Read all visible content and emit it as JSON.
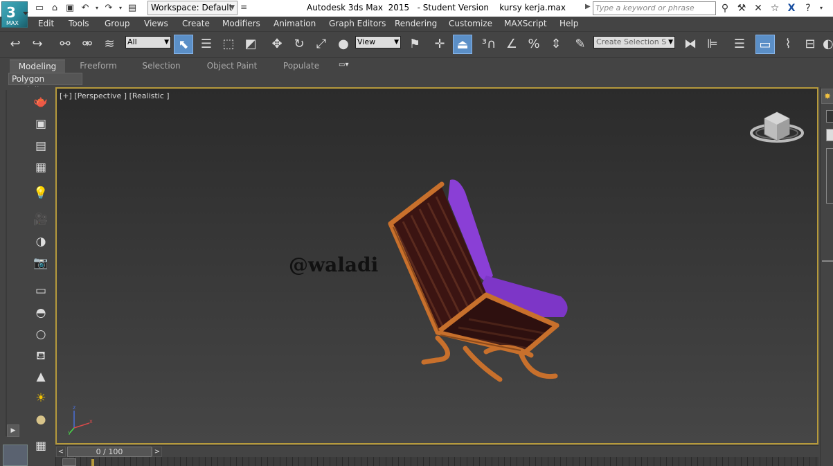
{
  "titlebar": {
    "logo_caption": "MAX",
    "workspace_label": "Workspace: Default",
    "app_title": "Autodesk 3ds Max  2015   - Student Version    kursy kerja.max",
    "search_placeholder": "Type a keyword or phrase"
  },
  "menu": {
    "items": [
      "Edit",
      "Tools",
      "Group",
      "Views",
      "Create",
      "Modifiers",
      "Animation",
      "Graph Editors",
      "Rendering",
      "Customize",
      "MAXScript",
      "Help"
    ]
  },
  "toolbar": {
    "selection_filter": "All",
    "reference_coord": "View",
    "named_selection_placeholder": "Create Selection Se"
  },
  "ribbon": {
    "tabs": [
      "Modeling",
      "Freeform",
      "Selection",
      "Object Paint",
      "Populate"
    ],
    "active_tab": "Modeling",
    "subpanel": "Polygon Modeling"
  },
  "viewport": {
    "label": "[+] [Perspective ] [Realistic ]",
    "watermark": "@waladi",
    "axis_labels": {
      "x": "x",
      "y": "y",
      "z": "z"
    }
  },
  "timeslider": {
    "frame_label": "0 / 100",
    "current_frame": 0,
    "total_frames": 100
  },
  "colors": {
    "accent_blue": "#5b8fc7",
    "viewport_border": "#b69a3c",
    "chair_cushion": "#8a3fd6",
    "chair_wood": "#c8702c"
  }
}
